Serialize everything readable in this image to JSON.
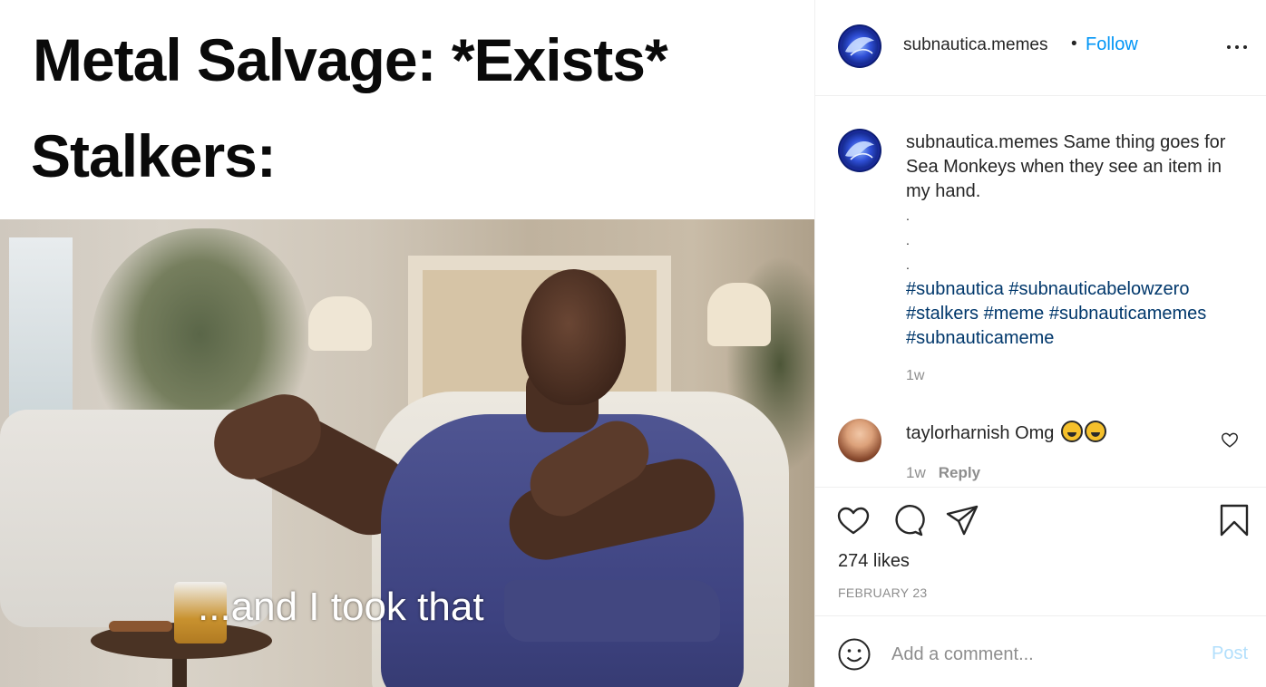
{
  "post": {
    "meme": {
      "line1": "Metal Salvage: *Exists*",
      "line2": "Stalkers:",
      "subtitle": "...and I took that"
    },
    "header": {
      "username": "subnautica.memes",
      "separator": "•",
      "follow_label": "Follow",
      "more_icon": "more-options-icon"
    },
    "caption": {
      "username": "subnautica.memes",
      "text": "Same thing goes for Sea Monkeys when they see an item in my hand.",
      "dots": [
        ".",
        ".",
        "."
      ],
      "hashtags": "#subnautica #subnauticabelowzero #stalkers #meme #subnauticamemes #subnauticameme",
      "time": "1w"
    },
    "comments": [
      {
        "username": "taylorharnish",
        "text": "Omg",
        "emojis": [
          "rofl-emoji",
          "rofl-emoji"
        ],
        "time": "1w",
        "reply_label": "Reply"
      }
    ],
    "actions": {
      "icons": [
        "heart-icon",
        "comment-icon",
        "share-icon",
        "bookmark-icon"
      ]
    },
    "likes": "274 likes",
    "date": "FEBRUARY 23",
    "add_comment": {
      "placeholder": "Add a comment...",
      "post_label": "Post"
    }
  },
  "colors": {
    "link_blue": "#0095f6",
    "hashtag_blue": "#00376b",
    "muted_gray": "#8e8e8e",
    "post_disabled": "#b2dffc",
    "redaction": "#424780"
  }
}
